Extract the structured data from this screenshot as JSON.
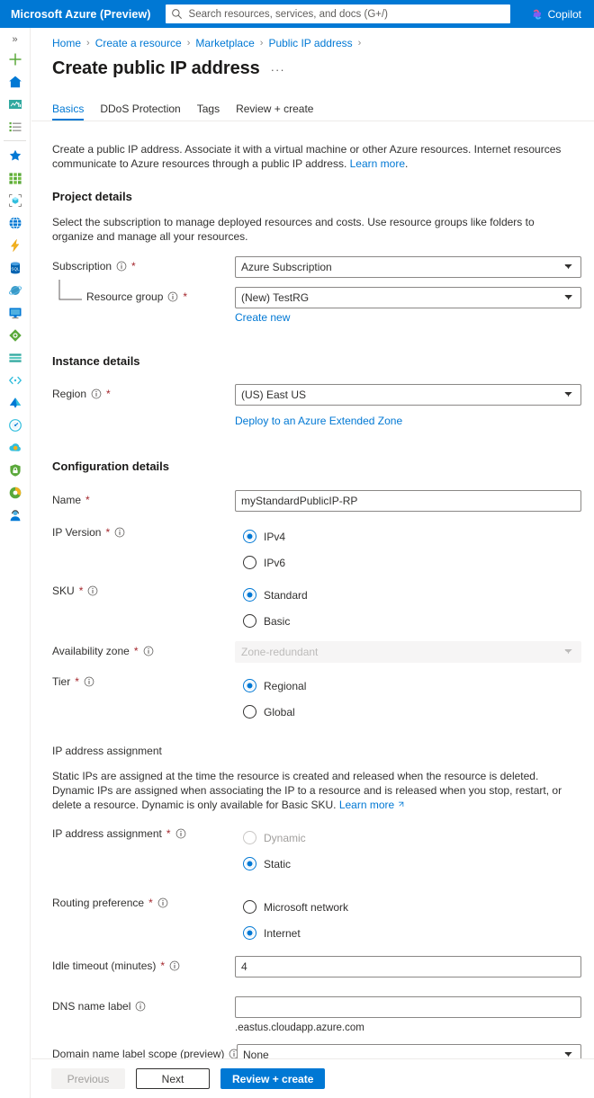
{
  "topbar": {
    "brand": "Microsoft Azure (Preview)",
    "search_placeholder": "Search resources, services, and docs (G+/)",
    "search_value": "",
    "copilot_label": "Copilot",
    "accent_color": "#0078d4"
  },
  "rail": {
    "expand_glyph": "»",
    "items": [
      {
        "name": "create-resource-icon",
        "label": "Create a resource"
      },
      {
        "name": "home-icon",
        "label": "Home"
      },
      {
        "name": "dashboard-icon",
        "label": "Dashboard"
      },
      {
        "name": "all-services-icon",
        "label": "All services"
      },
      {
        "name": "favorites-star-icon",
        "label": "Favorites"
      },
      {
        "name": "all-resources-icon",
        "label": "All resources"
      },
      {
        "name": "resource-groups-icon",
        "label": "Resource groups"
      },
      {
        "name": "app-services-icon",
        "label": "App Services"
      },
      {
        "name": "function-app-icon",
        "label": "Function App"
      },
      {
        "name": "sql-databases-icon",
        "label": "SQL databases"
      },
      {
        "name": "cosmos-db-icon",
        "label": "Azure Cosmos DB"
      },
      {
        "name": "virtual-machines-icon",
        "label": "Virtual machines"
      },
      {
        "name": "load-balancers-icon",
        "label": "Load balancers"
      },
      {
        "name": "storage-accounts-icon",
        "label": "Storage accounts"
      },
      {
        "name": "virtual-networks-icon",
        "label": "Virtual networks"
      },
      {
        "name": "entra-id-icon",
        "label": "Microsoft Entra ID"
      },
      {
        "name": "monitor-icon",
        "label": "Monitor"
      },
      {
        "name": "advisor-icon",
        "label": "Advisor"
      },
      {
        "name": "defender-icon",
        "label": "Microsoft Defender for Cloud"
      },
      {
        "name": "cost-management-icon",
        "label": "Cost Management + Billing"
      },
      {
        "name": "help-support-icon",
        "label": "Help + support"
      }
    ]
  },
  "breadcrumb": {
    "items": [
      {
        "label": "Home",
        "link": true
      },
      {
        "label": "Create a resource",
        "link": true
      },
      {
        "label": "Marketplace",
        "link": true
      },
      {
        "label": "Public IP address",
        "link": true
      }
    ],
    "separator": "›"
  },
  "page": {
    "title": "Create public IP address",
    "more_glyph": "···"
  },
  "tabs": [
    {
      "label": "Basics",
      "active": true
    },
    {
      "label": "DDoS Protection",
      "active": false
    },
    {
      "label": "Tags",
      "active": false
    },
    {
      "label": "Review + create",
      "active": false
    }
  ],
  "intro": {
    "text": "Create a public IP address. Associate it with a virtual machine or other Azure resources. Internet resources communicate to Azure resources through a public IP address. ",
    "link": "Learn more",
    "period": "."
  },
  "project_details": {
    "heading": "Project details",
    "description": "Select the subscription to manage deployed resources and costs. Use resource groups like folders to organize and manage all your resources.",
    "subscription": {
      "label": "Subscription",
      "required": "*",
      "value": "Azure Subscription",
      "options": [
        "Azure Subscription"
      ]
    },
    "resource_group": {
      "label": "Resource group",
      "required": "*",
      "value": "(New) TestRG",
      "options": [
        "(New) TestRG"
      ],
      "create_new": "Create new"
    }
  },
  "instance_details": {
    "heading": "Instance details",
    "region": {
      "label": "Region",
      "required": "*",
      "value": "(US) East US",
      "options": [
        "(US) East US"
      ],
      "extended_zone_link": "Deploy to an Azure Extended Zone"
    }
  },
  "configuration_details": {
    "heading": "Configuration details",
    "name": {
      "label": "Name",
      "required": "*",
      "value": "myStandardPublicIP-RP",
      "placeholder": ""
    },
    "ip_version": {
      "label": "IP Version",
      "required": "*",
      "options": [
        {
          "label": "IPv4",
          "selected": true,
          "disabled": false
        },
        {
          "label": "IPv6",
          "selected": false,
          "disabled": false
        }
      ]
    },
    "sku": {
      "label": "SKU",
      "required": "*",
      "options": [
        {
          "label": "Standard",
          "selected": true,
          "disabled": false
        },
        {
          "label": "Basic",
          "selected": false,
          "disabled": false
        }
      ]
    },
    "availability_zone": {
      "label": "Availability zone",
      "required": "*",
      "value": "Zone-redundant",
      "options": [
        "Zone-redundant"
      ],
      "disabled": true
    },
    "tier": {
      "label": "Tier",
      "required": "*",
      "options": [
        {
          "label": "Regional",
          "selected": true,
          "disabled": false
        },
        {
          "label": "Global",
          "selected": false,
          "disabled": false
        }
      ]
    },
    "ip_address_assignment_section": {
      "heading": "IP address assignment",
      "description": "Static IPs are assigned at the time the resource is created and released when the resource is deleted. Dynamic IPs are assigned when associating the IP to a resource and is released when you stop, restart, or delete a resource. Dynamic is only available for Basic SKU. ",
      "link": "Learn more",
      "label": "IP address assignment",
      "required": "*",
      "options": [
        {
          "label": "Dynamic",
          "selected": false,
          "disabled": true
        },
        {
          "label": "Static",
          "selected": true,
          "disabled": false
        }
      ]
    },
    "routing_preference": {
      "label": "Routing preference",
      "required": "*",
      "options": [
        {
          "label": "Microsoft network",
          "selected": false,
          "disabled": false
        },
        {
          "label": "Internet",
          "selected": true,
          "disabled": false
        }
      ]
    },
    "idle_timeout": {
      "label": "Idle timeout (minutes)",
      "required": "*",
      "value": "4",
      "placeholder": ""
    },
    "dns_name_label": {
      "label": "DNS name label",
      "value": "",
      "placeholder": "",
      "suffix": ".eastus.cloudapp.azure.com"
    },
    "domain_name_label_scope": {
      "label": "Domain name label scope (preview)",
      "value": "None",
      "options": [
        "None"
      ]
    }
  },
  "footer": {
    "previous": "Previous",
    "next": "Next",
    "review_create": "Review + create"
  }
}
